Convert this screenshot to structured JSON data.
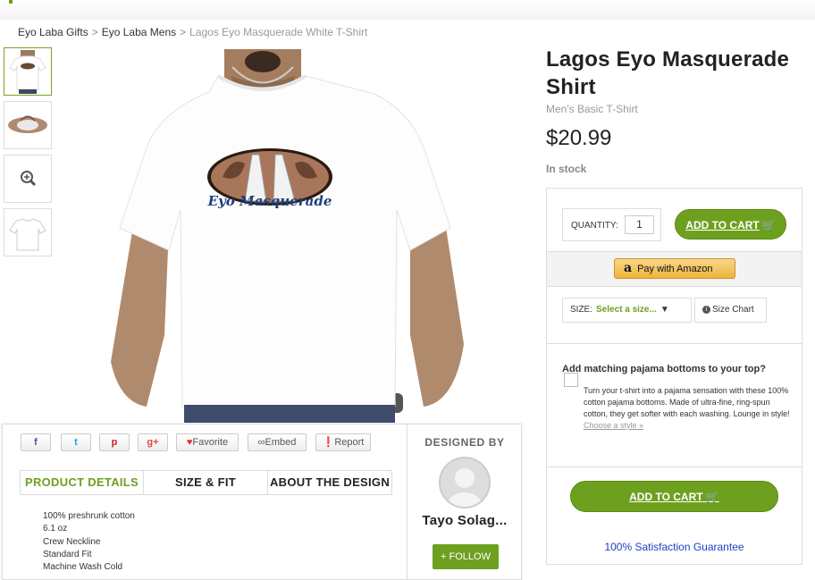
{
  "breadcrumb": {
    "items": [
      "Eyo Laba Gifts",
      "Eyo Laba Mens"
    ],
    "separator": ">",
    "current": "Lagos Eyo Masquerade White T-Shirt"
  },
  "product": {
    "title": "Lagos Eyo Masquerade Shirt",
    "subtitle": "Men's Basic T-Shirt",
    "price": "$20.99",
    "stock": "In stock",
    "design_text": "Eyo Masquerade"
  },
  "thumbnails": [
    {
      "name": "front-view",
      "active": true
    },
    {
      "name": "design-view",
      "active": false
    },
    {
      "name": "zoom",
      "active": false,
      "icon": "zoom-icon"
    },
    {
      "name": "outline-view",
      "active": false
    }
  ],
  "buybox": {
    "quantity_label": "QUANTITY:",
    "quantity_value": "1",
    "add_to_cart": "ADD TO CART",
    "pay_with_amazon": "Pay with Amazon",
    "amazon_logo": "a",
    "size_label": "SIZE:",
    "size_value": "Select a size...",
    "size_arrow": "▼",
    "size_chart": "Size Chart",
    "pajama_heading": "Add matching pajama bottoms to your top?",
    "pajama_text": "Turn your t-shirt into a pajama sensation with these 100% cotton pajama bottoms. Made of ultra-fine, ring-spun cotton, they get softer with each washing. Lounge in style!",
    "pajama_link": "Choose a style »",
    "add_to_cart_2": "ADD TO CART",
    "guarantee": "100% Satisfaction Guarantee",
    "accent_color": "#6ea01f"
  },
  "social": {
    "facebook": "f",
    "twitter": "t",
    "pinterest": "p",
    "googleplus": "g+",
    "favorite": "Favorite",
    "embed": "Embed",
    "report": "Report"
  },
  "tabs": [
    "PRODUCT DETAILS",
    "SIZE & FIT",
    "ABOUT THE DESIGN"
  ],
  "details": [
    "100% preshrunk cotton",
    "6.1 oz",
    "Crew Neckline",
    "Standard Fit",
    "Machine Wash Cold"
  ],
  "designer": {
    "heading": "DESIGNED BY",
    "name": "Tayo Solag...",
    "follow": "+ FOLLOW"
  }
}
